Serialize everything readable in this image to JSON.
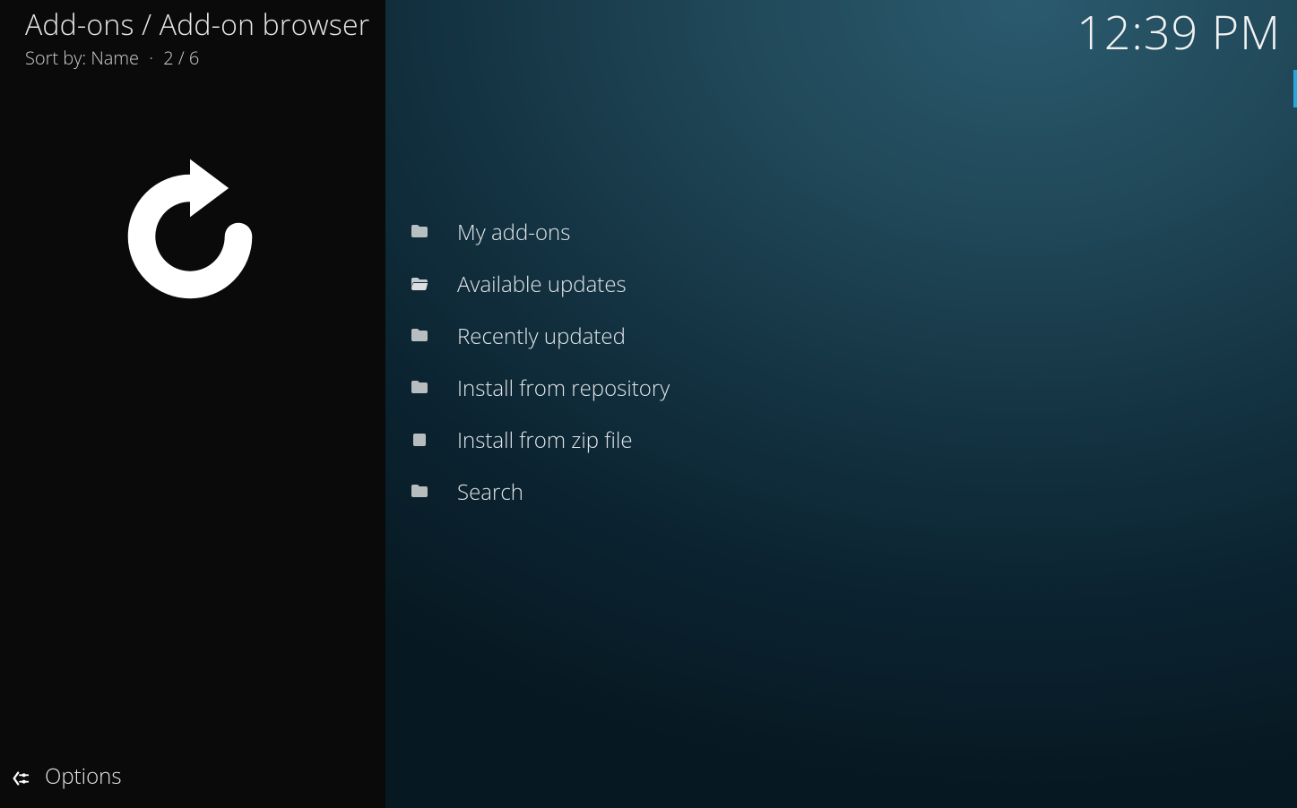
{
  "header": {
    "breadcrumb": "Add-ons / Add-on browser",
    "sort_prefix": "Sort by:",
    "sort_value": "Name",
    "position": "2 / 6"
  },
  "clock": "12:39 PM",
  "options_label": "Options",
  "items": [
    {
      "label": "My add-ons",
      "icon": "folder"
    },
    {
      "label": "Available updates",
      "icon": "folder-open"
    },
    {
      "label": "Recently updated",
      "icon": "folder"
    },
    {
      "label": "Install from repository",
      "icon": "folder"
    },
    {
      "label": "Install from zip file",
      "icon": "file"
    },
    {
      "label": "Search",
      "icon": "folder"
    }
  ]
}
